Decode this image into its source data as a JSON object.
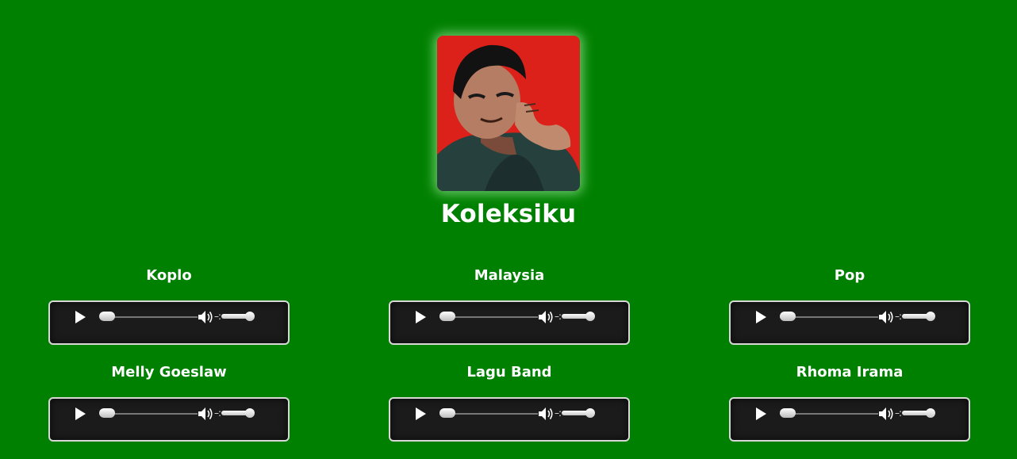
{
  "page": {
    "title": "Koleksiku"
  },
  "colors": {
    "background": "#008000",
    "player_background": "#1b1b1b",
    "player_border": "#d8d8d8",
    "text": "#ffffff"
  },
  "tracks": [
    {
      "label": "Koplo",
      "progress": 0,
      "volume": 1.0
    },
    {
      "label": "Malaysia",
      "progress": 0,
      "volume": 1.0
    },
    {
      "label": "Pop",
      "progress": 0,
      "volume": 1.0
    },
    {
      "label": "Melly Goeslaw",
      "progress": 0,
      "volume": 1.0
    },
    {
      "label": "Lagu Band",
      "progress": 0,
      "volume": 1.0
    },
    {
      "label": "Rhoma Irama",
      "progress": 0,
      "volume": 1.0
    }
  ],
  "icons": {
    "play": "play-icon",
    "volume": "volume-icon"
  }
}
